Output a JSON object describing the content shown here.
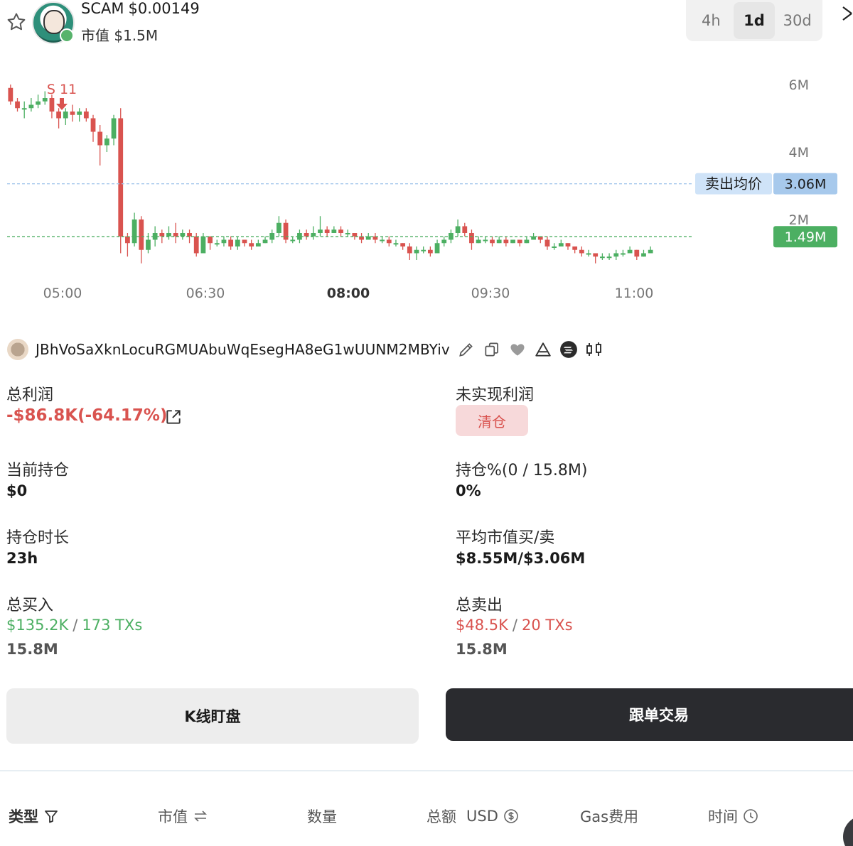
{
  "header": {
    "symbol": "SCAM",
    "price": "$0.00149",
    "mcap_label": "市值",
    "mcap_value": "$1.5M",
    "timeframes": [
      "4h",
      "1d",
      "30d"
    ],
    "active_timeframe": "1d"
  },
  "chart_data": {
    "type": "candlestick",
    "x_tick_labels": [
      "05:00",
      "06:30",
      "08:00",
      "09:30",
      "11:00"
    ],
    "bold_x_tick": "08:00",
    "y_tick_labels": [
      "6M",
      "4M",
      "2M"
    ],
    "y_ticks": [
      6000000,
      4000000,
      2000000
    ],
    "ylim": [
      0,
      7000000
    ],
    "annotation_marker": "S 11",
    "reference_lines": [
      {
        "label": "卖出均价",
        "value_label": "3.06M",
        "value": 3060000,
        "color": "#a7c9ec"
      },
      {
        "label": "",
        "value_label": "1.49M",
        "value": 1490000,
        "color": "#4caf62"
      }
    ],
    "colors": {
      "up": "#4caf62",
      "down": "#d9534f"
    },
    "candles_ohlc_millions": [
      [
        5.9,
        5.5,
        6.0,
        5.4
      ],
      [
        5.5,
        5.3,
        5.6,
        5.2
      ],
      [
        5.3,
        5.3,
        5.5,
        5.0
      ],
      [
        5.3,
        5.4,
        5.6,
        5.2
      ],
      [
        5.4,
        5.5,
        5.7,
        5.3
      ],
      [
        5.5,
        5.6,
        5.8,
        5.4
      ],
      [
        5.6,
        5.2,
        5.7,
        5.0
      ],
      [
        5.2,
        5.0,
        5.3,
        4.7
      ],
      [
        5.0,
        5.2,
        5.3,
        4.8
      ],
      [
        5.2,
        5.1,
        5.4,
        4.9
      ],
      [
        5.1,
        5.2,
        5.3,
        4.9
      ],
      [
        5.2,
        5.0,
        5.3,
        4.9
      ],
      [
        5.0,
        4.6,
        5.1,
        4.3
      ],
      [
        4.6,
        4.2,
        4.8,
        3.6
      ],
      [
        4.2,
        4.4,
        4.5,
        4.0
      ],
      [
        4.4,
        5.0,
        5.1,
        4.2
      ],
      [
        5.0,
        1.5,
        5.3,
        1.0
      ],
      [
        1.5,
        1.3,
        1.6,
        0.9
      ],
      [
        1.3,
        2.0,
        2.2,
        1.2
      ],
      [
        2.0,
        1.1,
        2.1,
        0.7
      ],
      [
        1.1,
        1.4,
        1.6,
        1.0
      ],
      [
        1.4,
        1.6,
        1.8,
        1.2
      ],
      [
        1.6,
        1.5,
        1.7,
        1.3
      ],
      [
        1.5,
        1.6,
        1.8,
        1.4
      ],
      [
        1.6,
        1.5,
        1.9,
        1.3
      ],
      [
        1.5,
        1.6,
        1.7,
        1.4
      ],
      [
        1.6,
        1.5,
        1.7,
        1.3
      ],
      [
        1.5,
        1.0,
        1.6,
        0.9
      ],
      [
        1.0,
        1.5,
        1.6,
        1.0
      ],
      [
        1.5,
        1.3,
        1.5,
        1.1
      ],
      [
        1.3,
        1.3,
        1.4,
        1.2
      ],
      [
        1.3,
        1.4,
        1.5,
        1.2
      ],
      [
        1.4,
        1.2,
        1.5,
        1.1
      ],
      [
        1.2,
        1.4,
        1.5,
        1.1
      ],
      [
        1.4,
        1.3,
        1.4,
        1.2
      ],
      [
        1.3,
        1.2,
        1.4,
        1.1
      ],
      [
        1.2,
        1.3,
        1.4,
        1.2
      ],
      [
        1.3,
        1.4,
        1.5,
        1.3
      ],
      [
        1.4,
        1.6,
        1.7,
        1.3
      ],
      [
        1.6,
        1.9,
        2.1,
        1.5
      ],
      [
        1.9,
        1.4,
        2.0,
        1.3
      ],
      [
        1.4,
        1.4,
        1.5,
        1.3
      ],
      [
        1.4,
        1.6,
        1.7,
        1.3
      ],
      [
        1.6,
        1.5,
        1.7,
        1.4
      ],
      [
        1.5,
        1.6,
        1.8,
        1.4
      ],
      [
        1.6,
        1.7,
        2.1,
        1.5
      ],
      [
        1.7,
        1.6,
        1.8,
        1.5
      ],
      [
        1.6,
        1.7,
        1.8,
        1.6
      ],
      [
        1.7,
        1.6,
        1.8,
        1.5
      ],
      [
        1.6,
        1.6,
        1.7,
        1.5
      ],
      [
        1.6,
        1.5,
        1.6,
        1.4
      ],
      [
        1.5,
        1.4,
        1.6,
        1.3
      ],
      [
        1.4,
        1.5,
        1.6,
        1.4
      ],
      [
        1.5,
        1.4,
        1.6,
        1.3
      ],
      [
        1.4,
        1.4,
        1.5,
        1.3
      ],
      [
        1.4,
        1.3,
        1.5,
        1.2
      ],
      [
        1.3,
        1.3,
        1.4,
        1.2
      ],
      [
        1.3,
        1.2,
        1.3,
        1.1
      ],
      [
        1.2,
        1.0,
        1.3,
        0.8
      ],
      [
        1.0,
        1.1,
        1.2,
        0.8
      ],
      [
        1.1,
        1.1,
        1.2,
        1.0
      ],
      [
        1.1,
        1.0,
        1.2,
        0.9
      ],
      [
        1.0,
        1.3,
        1.4,
        1.0
      ],
      [
        1.3,
        1.4,
        1.5,
        1.2
      ],
      [
        1.4,
        1.6,
        1.7,
        1.3
      ],
      [
        1.6,
        1.8,
        2.0,
        1.5
      ],
      [
        1.8,
        1.6,
        1.9,
        1.5
      ],
      [
        1.6,
        1.3,
        1.7,
        1.1
      ],
      [
        1.3,
        1.4,
        1.5,
        1.3
      ],
      [
        1.4,
        1.4,
        1.5,
        1.3
      ],
      [
        1.4,
        1.3,
        1.5,
        1.2
      ],
      [
        1.3,
        1.4,
        1.5,
        1.3
      ],
      [
        1.4,
        1.3,
        1.5,
        1.2
      ],
      [
        1.3,
        1.4,
        1.4,
        1.3
      ],
      [
        1.4,
        1.3,
        1.4,
        1.2
      ],
      [
        1.3,
        1.4,
        1.5,
        1.3
      ],
      [
        1.4,
        1.5,
        1.6,
        1.4
      ],
      [
        1.5,
        1.4,
        1.5,
        1.3
      ],
      [
        1.4,
        1.2,
        1.5,
        1.1
      ],
      [
        1.2,
        1.2,
        1.3,
        1.1
      ],
      [
        1.2,
        1.3,
        1.4,
        1.2
      ],
      [
        1.3,
        1.2,
        1.3,
        1.1
      ],
      [
        1.2,
        1.1,
        1.2,
        1.0
      ],
      [
        1.1,
        1.0,
        1.2,
        0.9
      ],
      [
        1.0,
        1.0,
        1.1,
        0.9
      ],
      [
        1.0,
        0.9,
        1.0,
        0.7
      ],
      [
        0.9,
        0.9,
        1.0,
        0.8
      ],
      [
        0.9,
        0.9,
        1.0,
        0.8
      ],
      [
        0.9,
        1.0,
        1.1,
        0.8
      ],
      [
        1.0,
        1.0,
        1.1,
        0.9
      ],
      [
        1.0,
        1.1,
        1.2,
        1.0
      ],
      [
        1.1,
        0.9,
        1.1,
        0.8
      ],
      [
        0.9,
        1.0,
        1.1,
        0.9
      ],
      [
        1.0,
        1.1,
        1.2,
        1.0
      ]
    ]
  },
  "wallet": {
    "address": "JBhVoSaXknLocuRGMUAbuWqEsegHA8eG1wUUNM2MBYiv"
  },
  "stats": {
    "total_profit_label": "总利润",
    "total_profit_value": "-$86.8K(-64.17%)",
    "unrealized_label": "未实现利润",
    "unrealized_badge": "清仓",
    "holding_label": "当前持仓",
    "holding_value": "$0",
    "holding_pct_label": "持仓%(0 / 15.8M)",
    "holding_pct_value": "0%",
    "duration_label": "持仓时长",
    "duration_value": "23h",
    "avg_mcap_label": "平均市值买/卖",
    "avg_mcap_value": "$8.55M/$3.06M",
    "total_buy_label": "总买入",
    "total_buy_amount": "$135.2K",
    "total_buy_txs": "173 TXs",
    "total_buy_qty": "15.8M",
    "total_sell_label": "总卖出",
    "total_sell_amount": "$48.5K",
    "total_sell_txs": "20 TXs",
    "total_sell_qty": "15.8M",
    "slash": "/"
  },
  "actions": {
    "kline_label": "K线盯盘",
    "copy_trade_label": "跟单交易"
  },
  "table_header": {
    "type": "类型",
    "mcap": "市值",
    "qty": "数量",
    "total": "总额",
    "currency": "USD",
    "gas": "Gas费用",
    "time": "时间"
  }
}
